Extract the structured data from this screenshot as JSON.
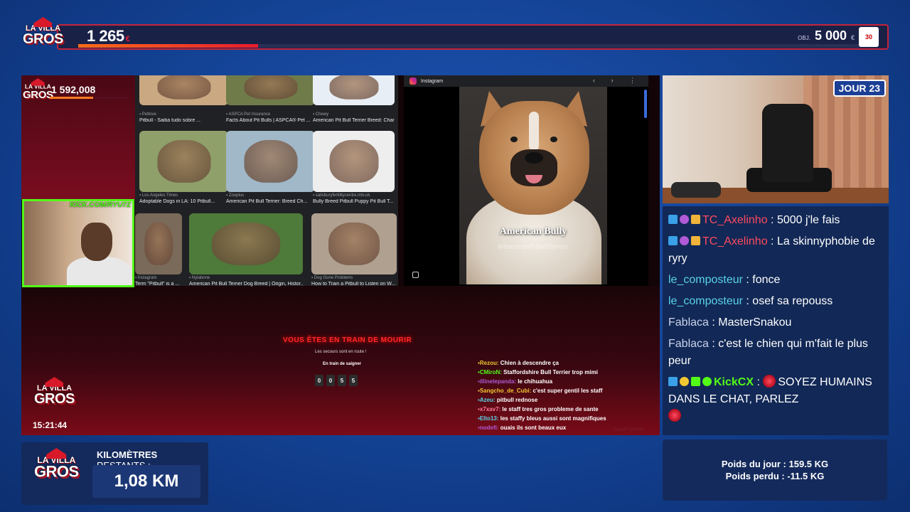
{
  "top_bar": {
    "logo_line1": "LA VILLA",
    "logo_line2": "GROS",
    "amount": "1 265",
    "currency": "€",
    "goal_label": "OBJ.",
    "goal_value": "5 000",
    "goal_currency": "€",
    "goal_badge": "30",
    "progress_pct": 23
  },
  "mini_overlay": {
    "logo_line1": "LA VILLA",
    "logo_line2": "GROS",
    "count": "1 592,008",
    "progress_pct": 55
  },
  "webcam": {
    "label": "KICK.COM/RYU7Z"
  },
  "image_results": [
    {
      "source": "Petlove",
      "title": "Pitbull - Saiba tudo sobre ...",
      "color": "#c9a882"
    },
    {
      "source": "ASPCA Pet Insurance",
      "title": "Facts About Pit Bulls | ASPCA® Pet ...",
      "color": "#6f7c4a"
    },
    {
      "source": "Chewy",
      "title": "American Pit Bull Terrier Breed: Characte...",
      "color": "#e8eef5"
    },
    {
      "source": "Los Angeles Times",
      "title": "Adoptable Dogs in LA: 10 Pitbull...",
      "color": "#8fa06a"
    },
    {
      "source": "Zooplus",
      "title": "American Pit Bull Terrier: Breed Ch...",
      "color": "#a0b8c8"
    },
    {
      "source": "salisburyfertilitycentre.mtv.uk",
      "title": "Bully Breed Pitbull Puppy Pit Bull T...",
      "color": "#eeeeee"
    },
    {
      "source": "Instagram",
      "title": "Term \"Pitbull\" is a ...",
      "color": "#7a6a5a"
    },
    {
      "source": "Nylabone",
      "title": "American Pit Bull Terrier Dog Breed | Origin, Histor...",
      "color": "#4e7a3a"
    },
    {
      "source": "Dog Gone Problems",
      "title": "How to Train a Pitbull to Listen on W...",
      "color": "#b0a090"
    }
  ],
  "viewer": {
    "source": "Instagram",
    "caption": "American Bully",
    "hashtag": "#AmericanPitbullTerrier",
    "nav": "‹ › ⋮"
  },
  "game": {
    "title": "VOUS ÊTES EN TRAIN DE MOURIR",
    "subtitle": "Les secours sont en route !",
    "label": "En train de saigner",
    "timer": [
      "0",
      "0",
      "5",
      "5"
    ],
    "watermark": "FiveM® (b3095)"
  },
  "game_chat": [
    {
      "user": "Rezou",
      "text": "Chien à descendre ça",
      "color": "#f2c832"
    },
    {
      "user": "CMiroN",
      "text": "Staffordshire Bull Terrier trop mimi",
      "color": "#53fc18"
    },
    {
      "user": "illinelepanda",
      "text": "le chihuahua",
      "color": "#b05ad6"
    },
    {
      "user": "Sangcho_de_Cubi",
      "text": "c'est super gentil les staff",
      "color": "#f2c832"
    },
    {
      "user": "Azeu",
      "text": "pitbull rednose",
      "color": "#5ad3e8"
    },
    {
      "user": "x7xav7",
      "text": "le staff tres gros probleme de sante",
      "color": "#ff7b9a"
    },
    {
      "user": "Elto13",
      "text": "les staffy bleus aussi sont magnifiques",
      "color": "#5ad3e8"
    },
    {
      "user": "nodefi",
      "text": "ouais ils sont beaux eux",
      "color": "#b05ad6"
    }
  ],
  "screen_logo": {
    "line1": "LA VILLA",
    "line2": "GROS",
    "clock": "15:21:44"
  },
  "room_cam": {
    "day_badge": "JOUR 23"
  },
  "chat": [
    {
      "user": "TC_Axelinho",
      "text": "5000 j'le fais",
      "user_class": "u-red",
      "badges": [
        "b-arrow",
        "b-z",
        "b-gift"
      ]
    },
    {
      "user": "TC_Axelinho",
      "text": "La skinnyphobie de ryry",
      "user_class": "u-red",
      "badges": [
        "b-arrow",
        "b-z",
        "b-gift"
      ]
    },
    {
      "user": "le_composteur",
      "text": "fonce",
      "user_class": "u-teal",
      "badges": []
    },
    {
      "user": "le_composteur",
      "text": "osef sa repouss",
      "user_class": "u-teal",
      "badges": []
    },
    {
      "user": "Fablaca",
      "text": "MasterSnakou",
      "user_class": "u-grey",
      "badges": []
    },
    {
      "user": "Fablaca",
      "text": "c'est le chien qui m'fait le plus peur",
      "user_class": "u-grey",
      "badges": []
    },
    {
      "user": "KickCX",
      "text": "SOYEZ HUMAINS DANS LE CHAT, PARLEZ",
      "user_class": "u-green",
      "badges": [
        "b-arrow",
        "b-coin",
        "b-money",
        "b-check"
      ]
    }
  ],
  "km_panel": {
    "logo_line1": "LA VILLA",
    "logo_line2": "GROS",
    "label_bold": "KILOMÈTRES",
    "label_thin": "RESTANTS :",
    "value": "1,08 KM"
  },
  "weight_panel": {
    "line1": "Poids du jour : 159.5 KG",
    "line2": "Poids perdu : -11.5 KG"
  }
}
